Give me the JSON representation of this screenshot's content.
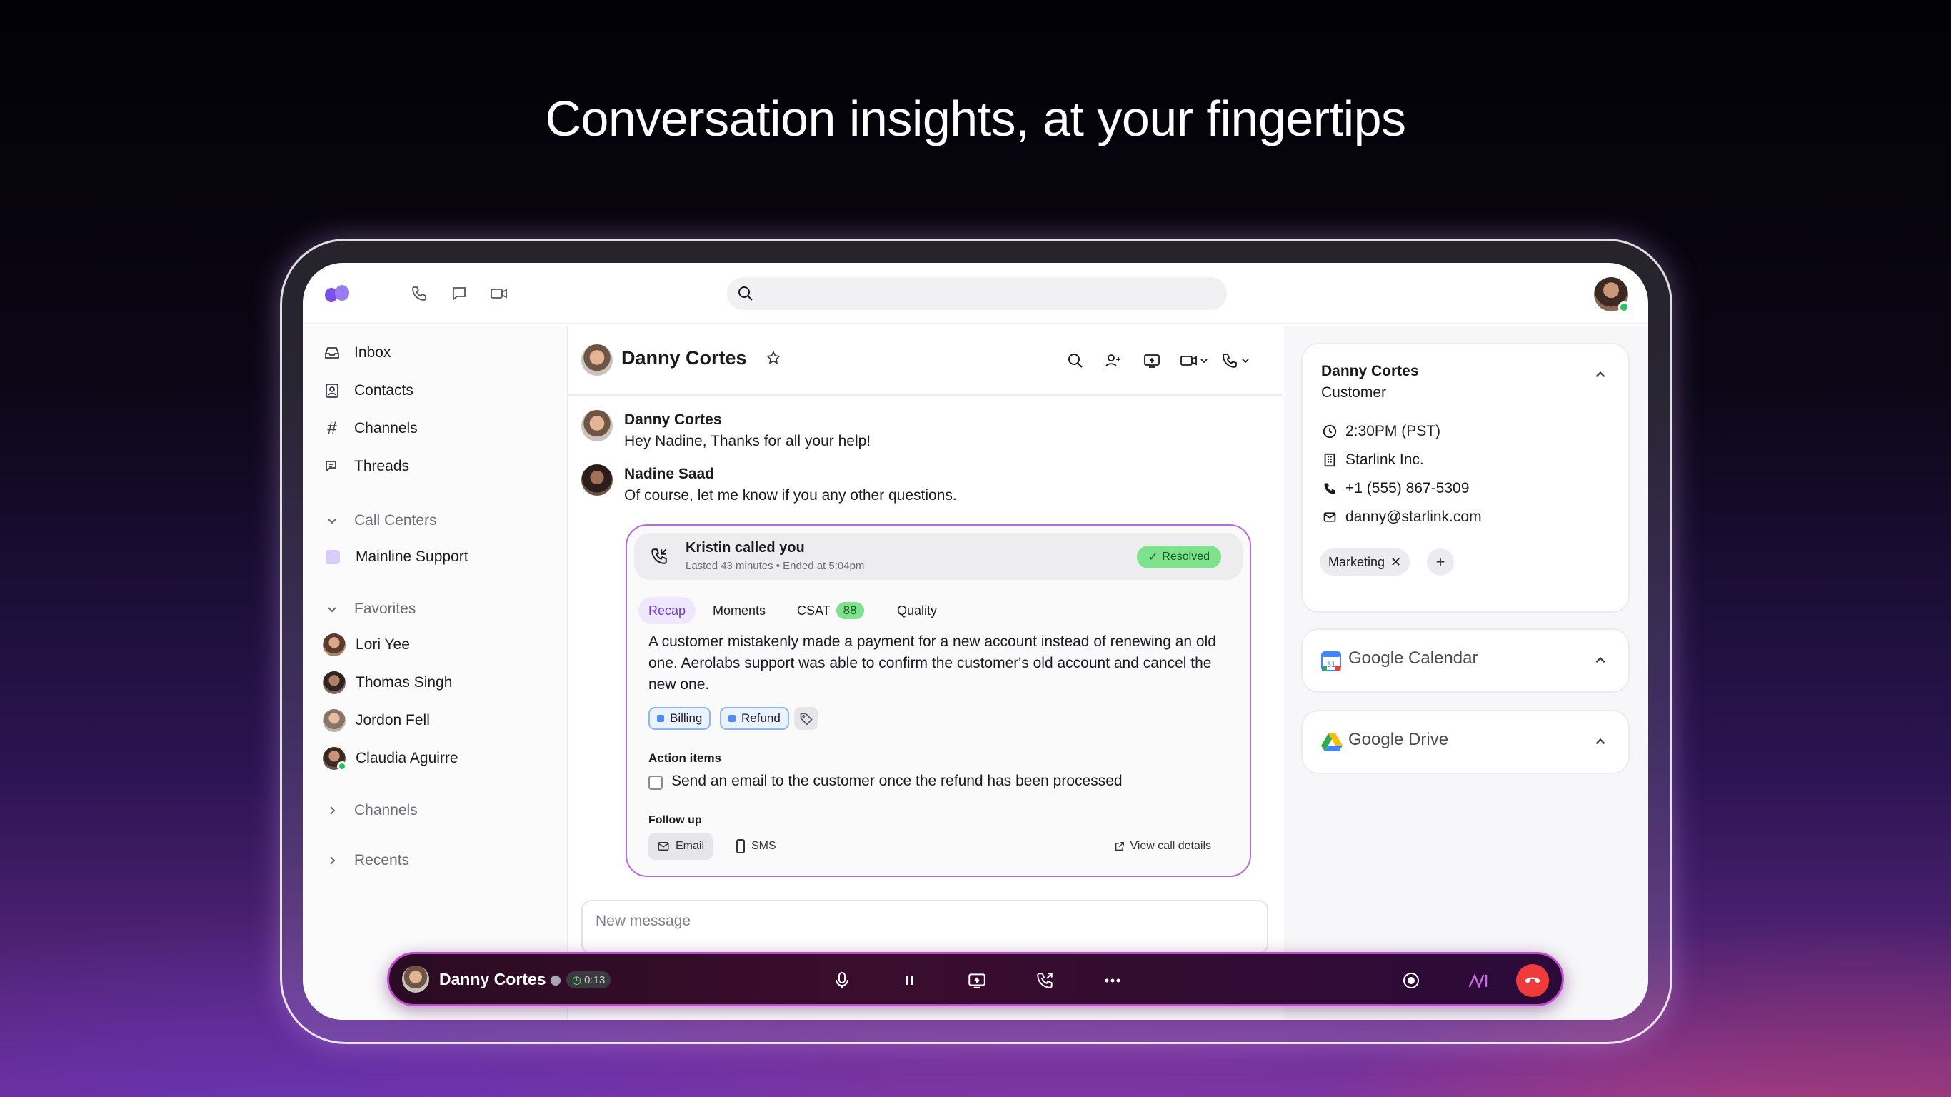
{
  "headline": "Conversation insights, at your fingertips",
  "colors": {
    "accent": "#6b3fc8",
    "resolved": "#7fe08e",
    "end_call": "#ef3b3b",
    "tag_blue": "#4c8ef5"
  },
  "topbar": {
    "icons": [
      "logo-icon",
      "phone-icon",
      "chat-icon",
      "video-icon"
    ],
    "search": {
      "placeholder": ""
    }
  },
  "sidebar": {
    "nav": [
      {
        "label": "Inbox",
        "icon": "inbox-icon"
      },
      {
        "label": "Contacts",
        "icon": "contacts-icon"
      },
      {
        "label": "Channels",
        "icon": "hash-icon"
      },
      {
        "label": "Threads",
        "icon": "threads-icon"
      }
    ],
    "call_centers": {
      "label": "Call Centers",
      "items": [
        "Mainline Support"
      ]
    },
    "favorites": {
      "label": "Favorites",
      "items": [
        "Lori Yee",
        "Thomas Singh",
        "Jordon Fell",
        "Claudia Aguirre"
      ]
    },
    "channels_label": "Channels",
    "recents_label": "Recents"
  },
  "chat": {
    "title": "Danny Cortes",
    "messages": [
      {
        "name": "Danny Cortes",
        "text": "Hey Nadine, Thanks for all your help!"
      },
      {
        "name": "Nadine Saad",
        "text": "Of course, let me know if you any other questions."
      }
    ],
    "call_card": {
      "title": "Kristin called you",
      "meta": "Lasted 43 minutes • Ended at 5:04pm",
      "status": "Resolved",
      "tabs": {
        "recap": "Recap",
        "moments": "Moments",
        "csat": "CSAT",
        "csat_score": "88",
        "quality": "Quality"
      },
      "recap": "A customer mistakenly made a payment for a new account instead of renewing an old one. Aerolabs support was able to confirm the customer's old account and cancel the new one.",
      "tags": [
        "Billing",
        "Refund"
      ],
      "action_items_label": "Action items",
      "action_item": "Send an email to the customer once the refund has been processed",
      "follow_up_label": "Follow up",
      "follow_up_email": "Email",
      "follow_up_sms": "SMS",
      "view_details": "View call details"
    },
    "composer_placeholder": "New message"
  },
  "contact": {
    "name": "Danny Cortes",
    "role": "Customer",
    "time": "2:30PM (PST)",
    "company": "Starlink Inc.",
    "phone": "+1 (555) 867-5309",
    "email": "danny@starlink.com",
    "tag": "Marketing"
  },
  "integrations": {
    "calendar": "Google Calendar",
    "drive": "Google Drive"
  },
  "callbar": {
    "name": "Danny Cortes",
    "timer": "0:13"
  }
}
